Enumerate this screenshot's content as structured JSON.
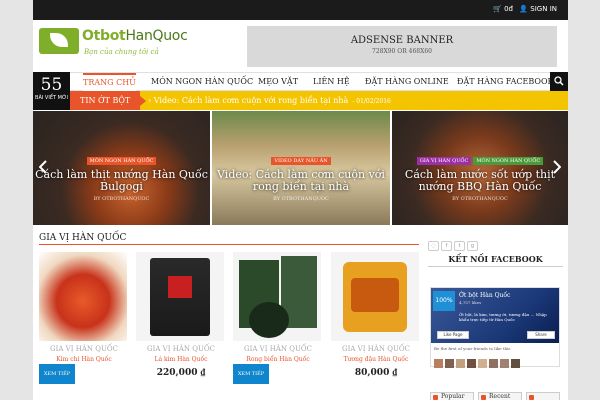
{
  "topbar": {
    "cart": "0đ",
    "signin": "SIGN IN"
  },
  "logo": {
    "name_a": "Otbot",
    "name_b": "HanQuoc",
    "tagline": "Bạn của chung tôi cả"
  },
  "banner": {
    "title": "ADSENSE BANNER",
    "size": "728X90 OR 468X60"
  },
  "counter": {
    "number": "55",
    "label": "BÀI VIẾT MỚI"
  },
  "nav": {
    "items": [
      "TRANG CHỦ",
      "MÓN NGON HÀN QUỐC",
      "MẸO VẶT",
      "LIÊN HỆ",
      "ĐẶT HÀNG ONLINE",
      "ĐẶT HÀNG FACEBOOK"
    ]
  },
  "ticker": {
    "label": "TIN ỚT BỘT",
    "headline": "Video: Cách làm cơm cuộn với rong biển tại nhà",
    "date": "- 01/02/2016"
  },
  "slides": [
    {
      "cats": [
        "MÓN NGON HÀN QUỐC"
      ],
      "title": "Cách làm thịt nướng Hàn Quốc Bulgogi",
      "by": "BY OTBOTHANQUOC"
    },
    {
      "cats": [
        "VIDEO DẠY NẤU ĂN"
      ],
      "title": "Video: Cách làm cơm cuộn với rong biển tại nhà",
      "by": "BY OTBOTHANQUOC"
    },
    {
      "cats": [
        "GIA VỊ HÀN QUỐC",
        "MÓN NGON HÀN QUỐC"
      ],
      "title": "Cách làm nước sốt ướp thịt nướng BBQ Hàn Quốc",
      "by": "BY OTBOTHANQUOC"
    }
  ],
  "section": {
    "title": "GIA VỊ HÀN QUỐC"
  },
  "products": [
    {
      "category": "GIA VỊ HÀN QUỐC",
      "name": "Kim chi Hàn Quốc",
      "price": "",
      "button": "XEM TIẾP"
    },
    {
      "category": "GIA VỊ HÀN QUỐC",
      "name": "Lá kim Hàn Quốc",
      "price": "220,000 ₫",
      "button": ""
    },
    {
      "category": "GIA VỊ HÀN QUỐC",
      "name": "Rong biển Hàn Quốc",
      "price": "",
      "button": "XEM TIẾP"
    },
    {
      "category": "GIA VỊ HÀN QUỐC",
      "name": "Tương đậu Hàn Quốc",
      "price": "80,000 ₫",
      "button": ""
    }
  ],
  "sidebar": {
    "connect_title": "KẾT NỐI FACEBOOK",
    "fb": {
      "badge": "100%",
      "page_name": "Ớt bột Hàn Quốc",
      "likes": "4,757 likes",
      "desc": "Ớt bột, lá kim, tương ớt, tương đậu ... Nhập khẩu trực tiếp từ Hàn Quốc",
      "like_btn": "Like Page",
      "share_btn": "Share",
      "first": "Be the first of your friends to like this"
    },
    "tabs": [
      "Popular",
      "Recent"
    ]
  },
  "colors": {
    "accent": "#e8552a",
    "ticker": "#f5c400",
    "button": "#0e85cc"
  }
}
